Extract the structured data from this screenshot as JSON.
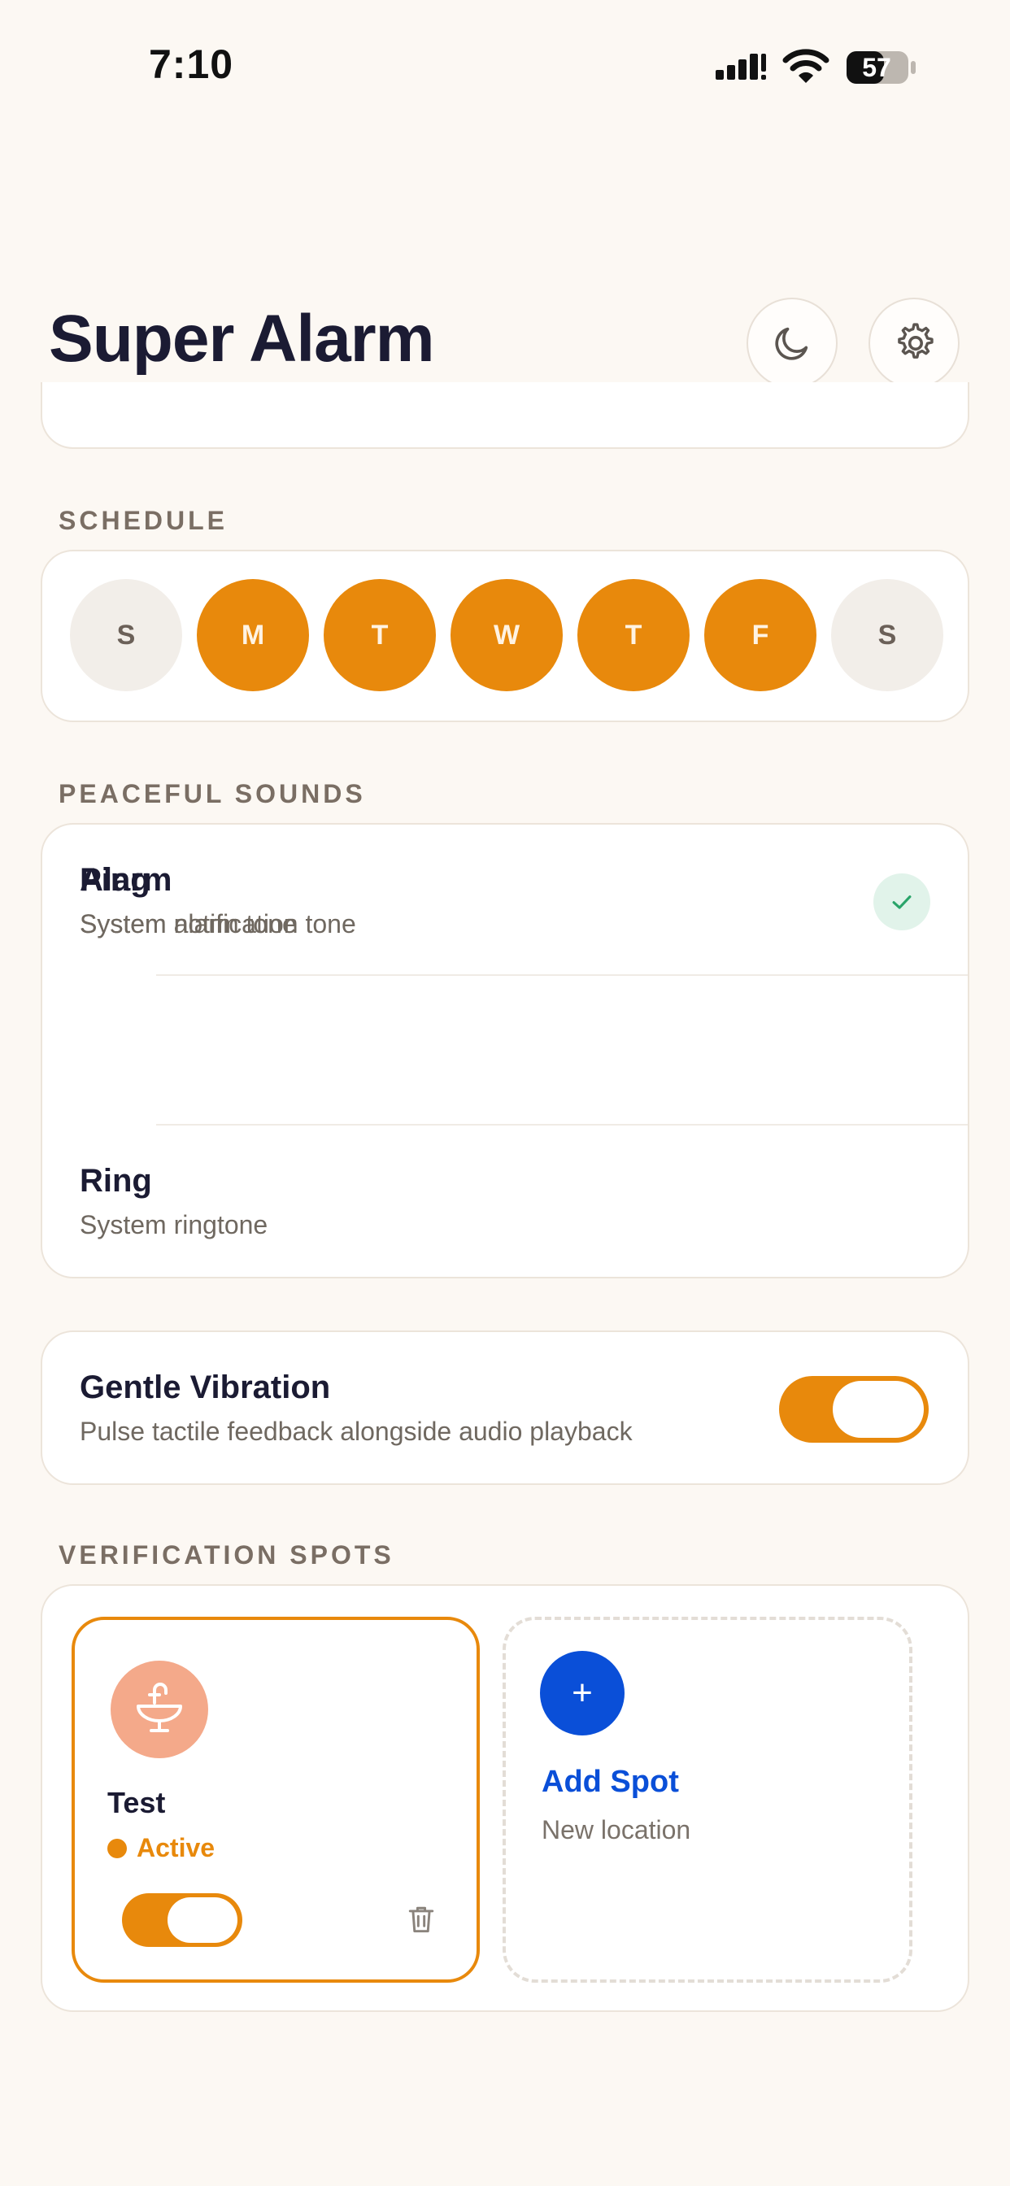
{
  "status_bar": {
    "time": "7:10",
    "battery": "57"
  },
  "header": {
    "title": "Super Alarm",
    "icons": [
      "moon-icon",
      "gear-icon"
    ]
  },
  "schedule": {
    "label": "SCHEDULE",
    "days": [
      {
        "letter": "S",
        "active": false
      },
      {
        "letter": "M",
        "active": true
      },
      {
        "letter": "T",
        "active": true
      },
      {
        "letter": "W",
        "active": true
      },
      {
        "letter": "T",
        "active": true
      },
      {
        "letter": "F",
        "active": true
      },
      {
        "letter": "S",
        "active": false
      }
    ]
  },
  "sounds": {
    "label": "PEACEFUL SOUNDS",
    "items": [
      {
        "name": "Alarm",
        "desc": "System alarm tone",
        "selected": true
      },
      {
        "name": "Ring",
        "desc": "System ringtone",
        "selected": false
      },
      {
        "name": "Ping",
        "desc": "System notification tone",
        "selected": false
      }
    ]
  },
  "vibration": {
    "title": "Gentle Vibration",
    "desc": "Pulse tactile feedback alongside audio playback",
    "enabled": true
  },
  "spots": {
    "label": "VERIFICATION SPOTS",
    "items": [
      {
        "name": "Test",
        "status": "Active",
        "enabled": true,
        "icon": "sink-icon"
      }
    ],
    "add": {
      "plus": "+",
      "label": "Add Spot",
      "desc": "New location"
    }
  },
  "colors": {
    "accent": "#e8890c",
    "background": "#fcf8f3",
    "link": "#0a4fd8",
    "check": "#2aa46a"
  }
}
